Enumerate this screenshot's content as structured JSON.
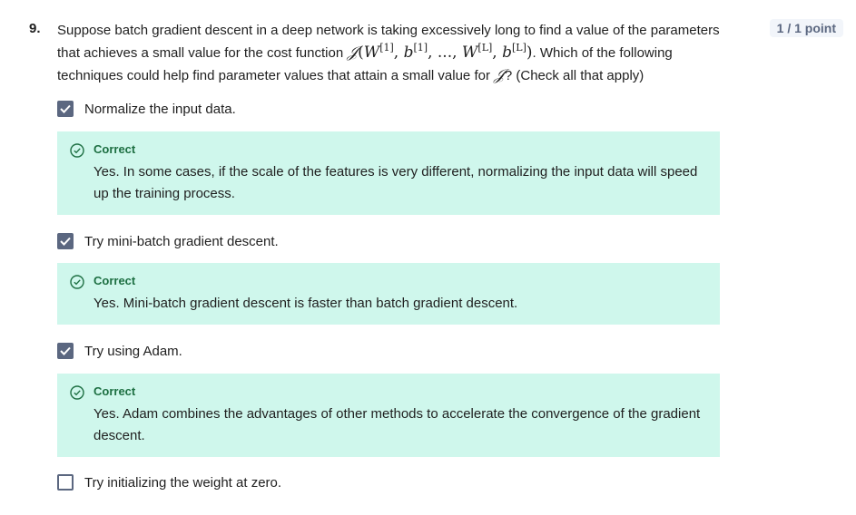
{
  "question": {
    "number": "9.",
    "text_part1": "Suppose batch gradient descent in a deep network is taking excessively long to find a value of the parameters that achieves a small value for the cost function ",
    "text_part2": ". Which of the following techniques could help find parameter values that attain a small value for ",
    "text_part3": "? (Check all that apply)",
    "math_J": "𝒥",
    "math_W": "W",
    "math_b": "b",
    "sup_1": "[1]",
    "sup_L": "[L]",
    "math_sep": ", ..., ",
    "score": "1 / 1 point"
  },
  "options": [
    {
      "label": "Normalize the input data.",
      "checked": true,
      "feedback_title": "Correct",
      "feedback_text": "Yes. In some cases, if the scale of the features is very different, normalizing the input data will speed up the training process."
    },
    {
      "label": "Try mini-batch gradient descent.",
      "checked": true,
      "feedback_title": "Correct",
      "feedback_text": "Yes. Mini-batch gradient descent is faster than batch gradient descent."
    },
    {
      "label": "Try using Adam.",
      "checked": true,
      "feedback_title": "Correct",
      "feedback_text": "Yes. Adam combines the advantages of other methods to accelerate the convergence of the gradient descent."
    },
    {
      "label": "Try initializing the weight at zero.",
      "checked": false
    }
  ],
  "colors": {
    "feedback_bg": "#cff7ec",
    "feedback_title": "#1d6f42",
    "checkbox": "#5b6780",
    "score_bg": "#f2f5fa"
  },
  "icons": {
    "checked": "check-icon",
    "feedback": "check-circle-icon"
  }
}
